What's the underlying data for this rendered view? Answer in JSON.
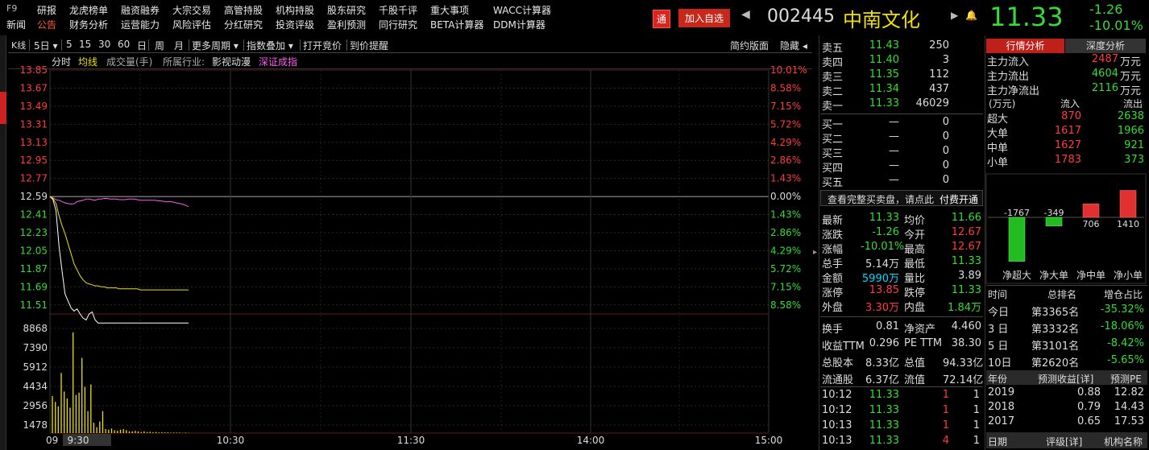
{
  "menu": {
    "row1": [
      "F9",
      "研报",
      "龙虎榜单",
      "融资融券",
      "大宗交易",
      "高管持股",
      "机构持股",
      "股东研究",
      "千股千评",
      "重大事项",
      "WACC计算器"
    ],
    "row2": [
      "新闻",
      "公告",
      "财务分析",
      "运营能力",
      "风险评估",
      "分红研究",
      "投资评级",
      "盈利预测",
      "同行研究",
      "BETA计算器",
      "DDM计算器"
    ]
  },
  "header": {
    "badge": "通",
    "add_watch": "加入自选",
    "code": "002445",
    "name": "中南文化",
    "price": "11.33",
    "change": "-1.26",
    "change_pct": "-10.01%"
  },
  "toolbar": {
    "items": [
      "K线",
      "5日 ▾",
      "5",
      "15",
      "30",
      "60",
      "日",
      "周",
      "月",
      "更多周期 ▾",
      "指数叠加 ▾",
      "打开竞价",
      "到价提醒"
    ],
    "right": [
      "简约版面",
      "隐藏 ◂"
    ]
  },
  "legend": {
    "items": [
      "分时",
      "均线",
      "成交量(手)",
      "所属行业:",
      "影视动漫",
      "深证成指"
    ]
  },
  "chart_data": {
    "type": "line",
    "ylabels_left": [
      "13.85",
      "13.67",
      "13.49",
      "13.31",
      "13.13",
      "12.95",
      "12.77",
      "12.59",
      "12.41",
      "12.23",
      "12.05",
      "11.87",
      "11.69",
      "11.51"
    ],
    "ylabels_right": [
      "10.01%",
      "8.58%",
      "7.15%",
      "5.72%",
      "4.29%",
      "2.86%",
      "1.43%",
      "0.00%",
      "1.43%",
      "2.86%",
      "4.29%",
      "5.72%",
      "7.15%",
      "8.58%"
    ],
    "vol_labels": [
      "8868",
      "7390",
      "5912",
      "4434",
      "2956",
      "1478"
    ],
    "xlabels": [
      "09",
      "9:30",
      "10:30",
      "11:30",
      "14:00",
      "15:00"
    ],
    "price_range": [
      11.33,
      13.85
    ],
    "price_series": [
      12.59,
      12.56,
      12.45,
      12.1,
      11.85,
      11.62,
      11.55,
      11.48,
      11.45,
      11.47,
      11.42,
      11.38,
      11.36,
      11.42,
      11.44,
      11.36,
      11.33,
      11.33,
      11.33,
      11.33,
      11.33,
      11.33,
      11.33,
      11.33,
      11.33,
      11.33,
      11.33,
      11.33,
      11.33,
      11.33,
      11.33,
      11.33,
      11.33,
      11.33,
      11.33,
      11.33,
      11.33,
      11.33,
      11.33,
      11.33,
      11.33,
      11.33,
      11.33,
      11.33,
      11.33,
      11.33,
      11.33
    ],
    "avg_series": [
      12.59,
      12.57,
      12.52,
      12.4,
      12.3,
      12.22,
      12.12,
      12.02,
      11.92,
      11.86,
      11.8,
      11.76,
      11.73,
      11.72,
      11.71,
      11.7,
      11.7,
      11.69,
      11.69,
      11.68,
      11.68,
      11.68,
      11.68,
      11.67,
      11.67,
      11.67,
      11.67,
      11.67,
      11.67,
      11.67,
      11.66,
      11.66,
      11.66,
      11.66,
      11.66,
      11.66,
      11.66,
      11.66,
      11.66,
      11.66,
      11.66,
      11.66,
      11.66,
      11.66,
      11.66,
      11.66,
      11.66
    ],
    "index_pct_series": [
      0,
      -0.1,
      -0.25,
      -0.3,
      -0.4,
      -0.5,
      -0.55,
      -0.6,
      -0.58,
      -0.4,
      -0.35,
      -0.3,
      -0.2,
      -0.2,
      -0.25,
      -0.3,
      -0.2,
      -0.2,
      -0.15,
      -0.15,
      -0.2,
      -0.2,
      -0.2,
      -0.25,
      -0.25,
      -0.25,
      -0.2,
      -0.2,
      -0.2,
      -0.25,
      -0.3,
      -0.3,
      -0.3,
      -0.3,
      -0.3,
      -0.3,
      -0.35,
      -0.35,
      -0.4,
      -0.4,
      -0.4,
      -0.45,
      -0.5,
      -0.55,
      -0.6,
      -0.7,
      -0.8
    ],
    "volume_series": [
      3200,
      2700,
      2300,
      5200,
      3600,
      3000,
      2200,
      8700,
      3300,
      3500,
      6500,
      4000,
      1900,
      4200,
      900,
      500,
      1000,
      1900,
      350,
      300,
      400,
      250,
      200,
      300,
      350,
      250,
      150,
      150,
      200,
      150,
      100,
      150,
      100,
      120,
      80,
      100,
      60,
      80,
      60,
      60,
      40,
      50,
      40,
      50,
      30,
      40,
      30
    ],
    "volume_max": 9600
  },
  "orderbook": {
    "sells": [
      {
        "label": "卖五",
        "price": "11.43",
        "vol": "250"
      },
      {
        "label": "卖四",
        "price": "11.40",
        "vol": "3"
      },
      {
        "label": "卖三",
        "price": "11.35",
        "vol": "112"
      },
      {
        "label": "卖二",
        "price": "11.34",
        "vol": "437"
      },
      {
        "label": "卖一",
        "price": "11.33",
        "vol": "46029"
      }
    ],
    "buys": [
      {
        "label": "买一",
        "price": "—",
        "vol": "0"
      },
      {
        "label": "买二",
        "price": "—",
        "vol": "0"
      },
      {
        "label": "买三",
        "price": "—",
        "vol": "0"
      },
      {
        "label": "买四",
        "price": "—",
        "vol": "0"
      },
      {
        "label": "买五",
        "price": "—",
        "vol": "0"
      }
    ],
    "notice": "查看完整买卖盘，请点此",
    "notice_link": "付费开通"
  },
  "quote": [
    {
      "l1": "最新",
      "v1": "11.33",
      "l2": "均价",
      "v2": "11.66"
    },
    {
      "l1": "涨跌",
      "v1": "-1.26",
      "l2": "今开",
      "v2": "12.67"
    },
    {
      "l1": "涨幅",
      "v1": "-10.01%",
      "l2": "最高",
      "v2": "12.67"
    },
    {
      "l1": "总手",
      "v1": "5.14万",
      "l2": "最低",
      "v2": "11.33"
    },
    {
      "l1": "金额",
      "v1": "5990万",
      "l2": "量比",
      "v2": "3.89"
    },
    {
      "l1": "涨停",
      "v1": "13.85",
      "l2": "跌停",
      "v2": "11.33"
    },
    {
      "l1": "外盘",
      "v1": "3.30万",
      "l2": "内盘",
      "v2": "1.84万"
    }
  ],
  "fundamentals": [
    {
      "l1": "换手",
      "v1": "0.81",
      "l2": "净资产",
      "v2": "4.460"
    },
    {
      "l1": "收益TTM",
      "v1": "0.296",
      "l2": "PE TTM",
      "v2": "38.30"
    },
    {
      "l1": "总股本",
      "v1": "8.33亿",
      "l2": "总值",
      "v2": "94.33亿"
    },
    {
      "l1": "流通股",
      "v1": "6.37亿",
      "l2": "流值",
      "v2": "72.14亿"
    }
  ],
  "ticks": [
    {
      "time": "10:12",
      "price": "11.33",
      "vol": "1",
      "flag": "1"
    },
    {
      "time": "10:12",
      "price": "11.33",
      "vol": "1",
      "flag": "1"
    },
    {
      "time": "10:13",
      "price": "11.33",
      "vol": "1",
      "flag": "1"
    },
    {
      "time": "10:13",
      "price": "11.33",
      "vol": "4",
      "flag": "1"
    }
  ],
  "analysis": {
    "tabs": [
      "行情分析",
      "深度分析"
    ],
    "flows": [
      {
        "label": "主力流入",
        "value": "2487",
        "unit": "万元"
      },
      {
        "label": "主力流出",
        "value": "4604",
        "unit": "万元"
      },
      {
        "label": "主力净流出",
        "value": "2116",
        "unit": "万元"
      }
    ],
    "table_head": [
      "(万元)",
      "流入",
      "流出"
    ],
    "table": [
      {
        "label": "超大",
        "in": "870",
        "out": "2638"
      },
      {
        "label": "大单",
        "in": "1617",
        "out": "1966"
      },
      {
        "label": "中单",
        "in": "1627",
        "out": "921"
      },
      {
        "label": "小单",
        "in": "1783",
        "out": "373"
      }
    ],
    "net_bars": [
      {
        "label": "净超大",
        "value": -1767,
        "text": "-1767"
      },
      {
        "label": "净大单",
        "value": -349,
        "text": "-349"
      },
      {
        "label": "净中单",
        "value": 706,
        "text": "706"
      },
      {
        "label": "净小单",
        "value": 1410,
        "text": "1410"
      }
    ],
    "rank_head": [
      "时间",
      "总排名",
      "增仓占比"
    ],
    "ranks": [
      {
        "period": "今日",
        "rank": "第3365名",
        "pct": "-35.32%"
      },
      {
        "period": "3 日",
        "rank": "第3332名",
        "pct": "-18.06%"
      },
      {
        "period": "5 日",
        "rank": "第3101名",
        "pct": "-8.42%"
      },
      {
        "period": "10日",
        "rank": "第2620名",
        "pct": "-5.65%"
      }
    ],
    "eps_head": [
      "年份",
      "预测收益[详]",
      "预测PE"
    ],
    "eps": [
      {
        "year": "2019",
        "eps": "0.88",
        "pe": "12.82"
      },
      {
        "year": "2018",
        "eps": "0.79",
        "pe": "14.43"
      },
      {
        "year": "2017",
        "eps": "0.65",
        "pe": "17.53"
      }
    ],
    "footer": [
      "日期",
      "评级[详]",
      "机构名称"
    ]
  },
  "colors": {
    "up": "#ff3b3b",
    "down": "#33dd33",
    "price_line": "#ffffff",
    "avg_line": "#f0e000",
    "index_line": "#ff5cf0",
    "volume": "#f0e000"
  }
}
